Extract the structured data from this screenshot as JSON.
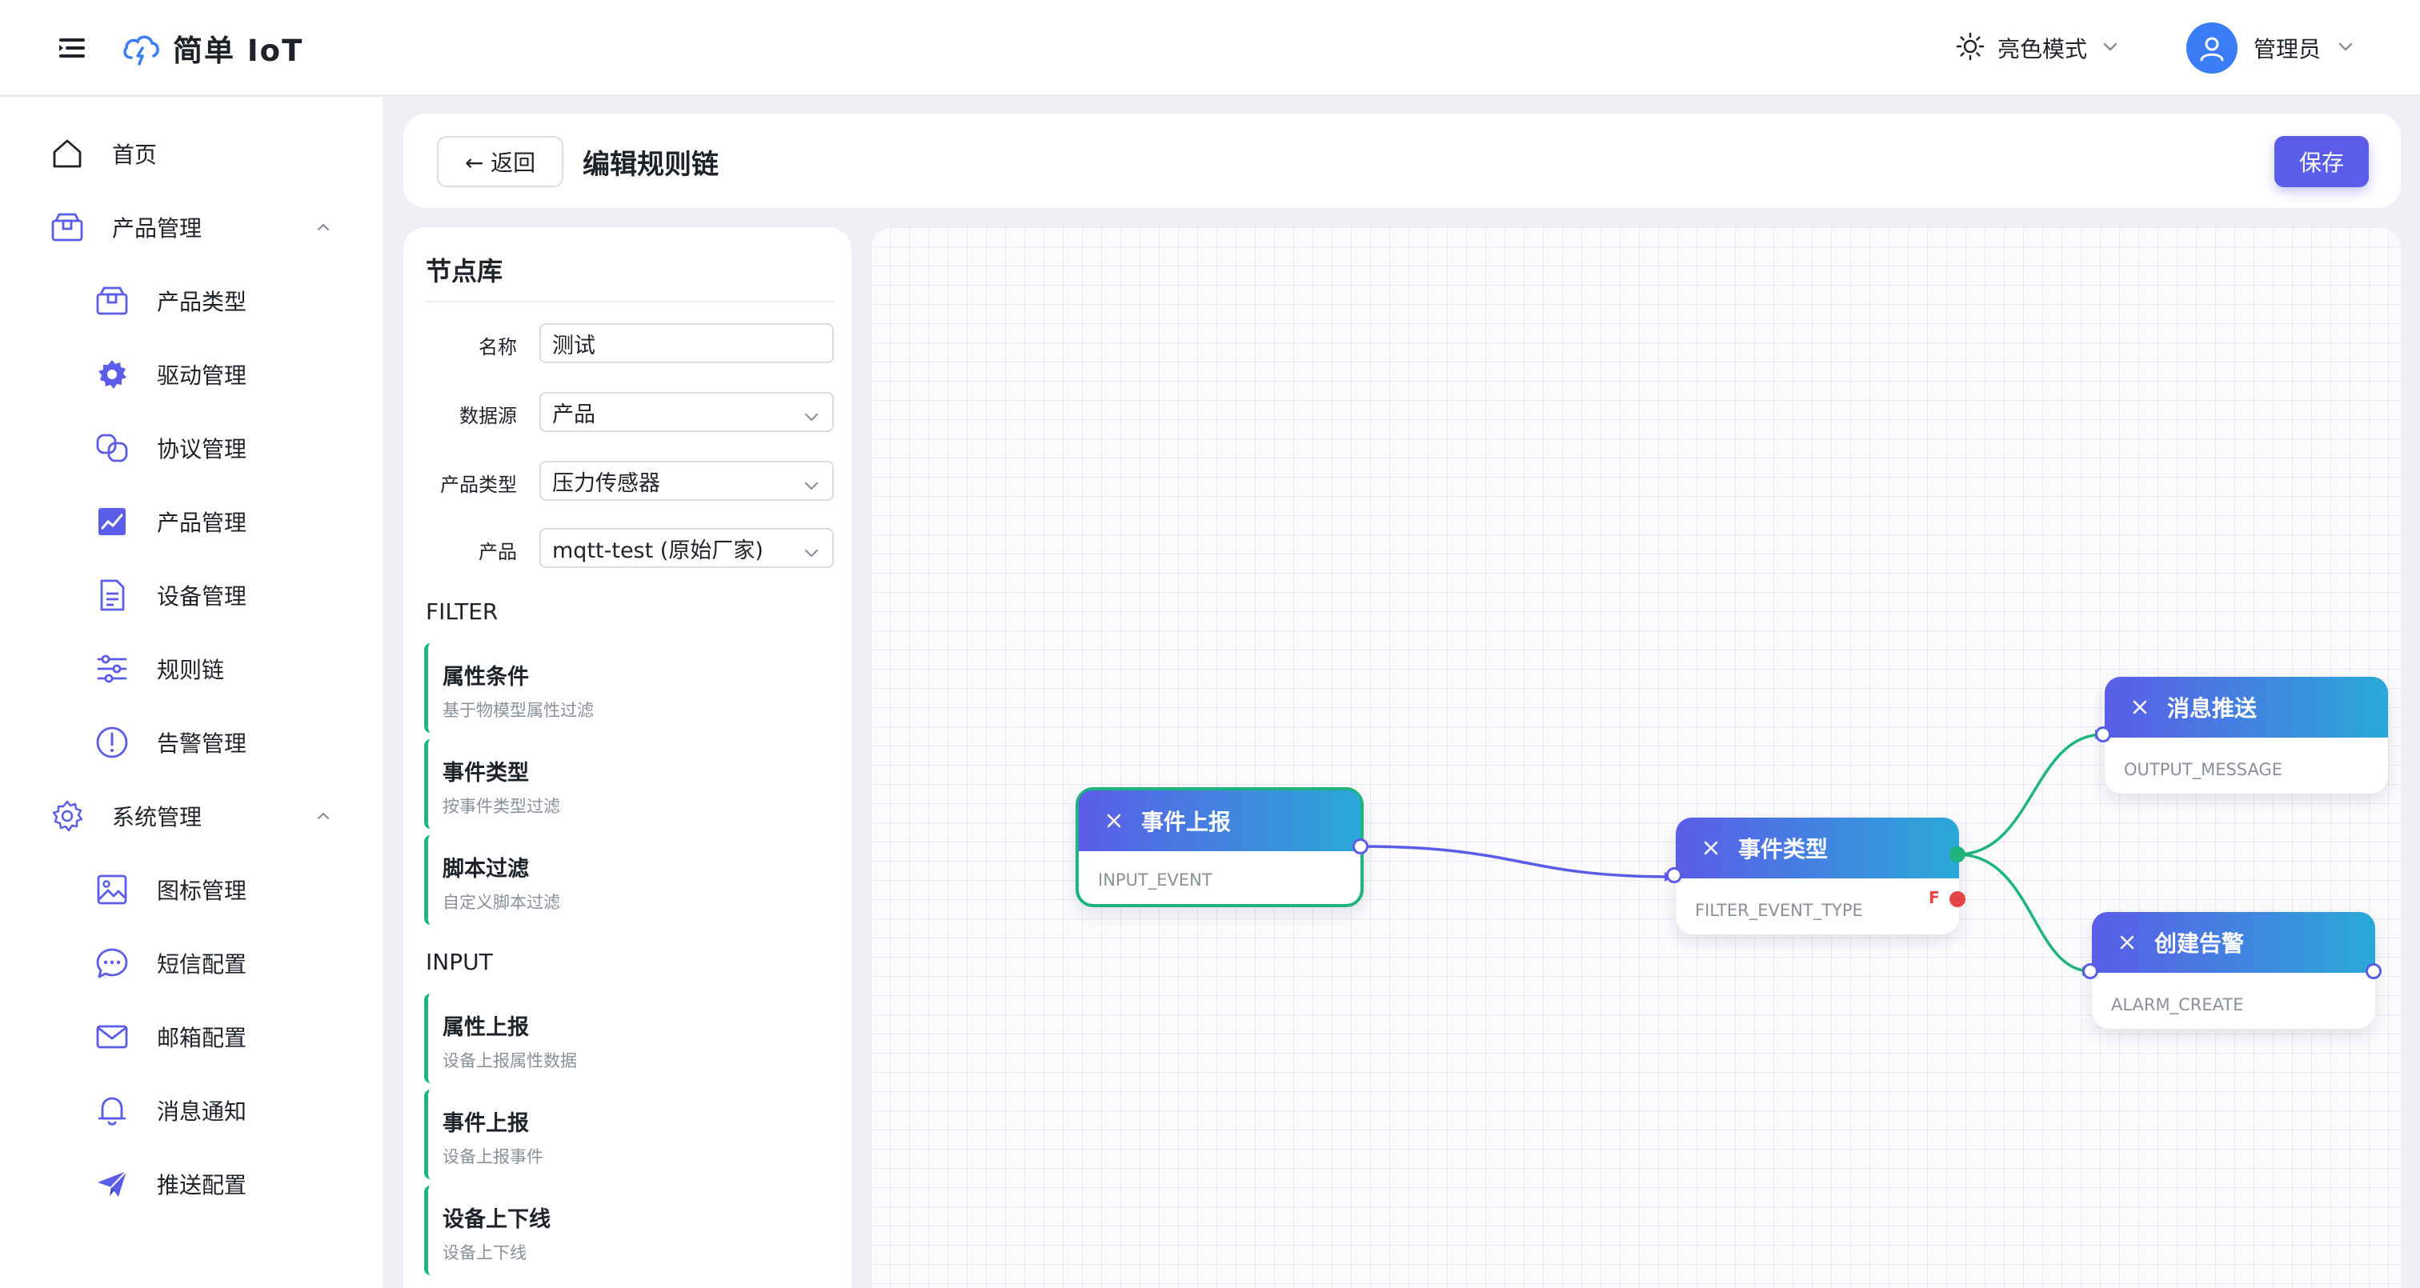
{
  "app": {
    "name": "简单 IoT"
  },
  "header": {
    "theme_label": "亮色模式",
    "user_label": "管理员"
  },
  "sidebar": {
    "items": [
      {
        "label": "首页",
        "icon": "home-icon"
      },
      {
        "label": "产品管理",
        "icon": "box-icon",
        "expanded": true
      },
      {
        "label": "产品类型",
        "icon": "package-icon"
      },
      {
        "label": "驱动管理",
        "icon": "gear-icon"
      },
      {
        "label": "协议管理",
        "icon": "link-icon"
      },
      {
        "label": "产品管理",
        "icon": "chart-icon"
      },
      {
        "label": "设备管理",
        "icon": "document-icon"
      },
      {
        "label": "规则链",
        "icon": "sliders-icon"
      },
      {
        "label": "告警管理",
        "icon": "alert-icon"
      },
      {
        "label": "系统管理",
        "icon": "settings-icon",
        "expanded": true
      },
      {
        "label": "图标管理",
        "icon": "image-icon"
      },
      {
        "label": "短信配置",
        "icon": "chat-icon"
      },
      {
        "label": "邮箱配置",
        "icon": "mail-icon"
      },
      {
        "label": "消息通知",
        "icon": "bell-icon"
      },
      {
        "label": "推送配置",
        "icon": "send-icon"
      }
    ]
  },
  "page": {
    "back_label": "← 返回",
    "title": "编辑规则链",
    "save_label": "保存"
  },
  "library": {
    "title": "节点库",
    "form": {
      "name_label": "名称",
      "name_value": "测试",
      "source_label": "数据源",
      "source_value": "产品",
      "type_label": "产品类型",
      "type_value": "压力传感器",
      "product_label": "产品",
      "product_value": "mqtt-test (原始厂家)"
    },
    "sections": [
      {
        "title": "FILTER",
        "nodes": [
          {
            "title": "属性条件",
            "desc": "基于物模型属性过滤"
          },
          {
            "title": "事件类型",
            "desc": "按事件类型过滤"
          },
          {
            "title": "脚本过滤",
            "desc": "自定义脚本过滤"
          }
        ]
      },
      {
        "title": "INPUT",
        "nodes": [
          {
            "title": "属性上报",
            "desc": "设备上报属性数据"
          },
          {
            "title": "事件上报",
            "desc": "设备上报事件"
          },
          {
            "title": "设备上下线",
            "desc": "设备上下线"
          }
        ]
      }
    ]
  },
  "canvas": {
    "nodes": [
      {
        "name": "事件上报",
        "type": "INPUT_EVENT",
        "selected": true
      },
      {
        "name": "事件类型",
        "type": "FILTER_EVENT_TYPE",
        "false_label": "F"
      },
      {
        "name": "消息推送",
        "type": "OUTPUT_MESSAGE"
      },
      {
        "name": "创建告警",
        "type": "ALARM_CREATE"
      }
    ]
  },
  "colors": {
    "accent": "#5b5ce8",
    "gradient_end": "#2aa9d8",
    "true_edge": "#1fb47d",
    "false_port": "#e54545"
  }
}
